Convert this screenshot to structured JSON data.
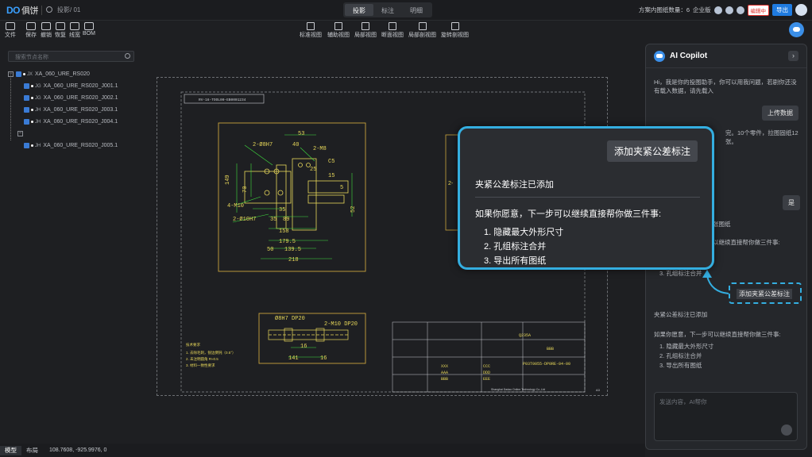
{
  "app": {
    "logo_mark": "DO",
    "brand": "俱饼",
    "doc_title": "投影/ 01"
  },
  "top_tabs": [
    "投影",
    "标注",
    "明细"
  ],
  "top_right": {
    "instance_info": "方案内图纸数量：6",
    "enterprise": "企业版",
    "edit_btn": "编辑中",
    "export_btn": "导出"
  },
  "toolbar": {
    "left": [
      "文件",
      "保存",
      "撤销",
      "恢复",
      "线宽",
      "BOM"
    ],
    "center": [
      "标准视图",
      "辅助视图",
      "局部视图",
      "断面视图",
      "局部剖视图",
      "旋转剖视图"
    ]
  },
  "sidebar": {
    "search_placeholder": "搜索节点名称",
    "root": "XA_060_URE_RS020",
    "children": [
      "XA_060_URE_RS020_J001.1",
      "XA_060_URE_RS020_J002.1",
      "XA_060_URE_RS020_J003.1",
      "XA_060_URE_RS020_J004.1",
      "XA_060_URE_RS020_J005.1"
    ],
    "tags": [
      "JX",
      "JG",
      "JG",
      "JH",
      "JH"
    ]
  },
  "drawing": {
    "title_block": "RV-16-TOOL00-EB0001234",
    "dims": [
      "53",
      "2-Ø8H7",
      "40",
      "2-M8",
      "149",
      "70",
      "25",
      "C5",
      "15",
      "4-M10",
      "35",
      "2-Ø10H7",
      "35",
      "89",
      "158",
      "179.5",
      "139.5",
      "50",
      "218",
      "52",
      "5"
    ],
    "section_dims": [
      "Ø8H7 DP20",
      "2-M10 DP20",
      "16",
      "141",
      "16"
    ],
    "notes_title": "技术要求",
    "notes": [
      "1. 去除毛刺，锐边倒钝（0.5°）",
      "2. 未注明圆角 R≈0.5",
      "3. 材料一致性要求"
    ],
    "tb_mat": "Q235A",
    "tb_part": "P03T0055-DP0RE-04-00",
    "tb_company": "Shanghai Dadao Online Technology Co.,Ltd",
    "tb_codes": [
      "XXX",
      "AAA",
      "BBB",
      "CCC",
      "DDD",
      "EEE"
    ],
    "tb_bbb": "BBB",
    "tb_scale": "A3"
  },
  "status_bar": {
    "tabs": [
      "模型",
      "布局"
    ],
    "coords": "108.7608,  -925.9976,  0"
  },
  "copilot": {
    "title": "AI Copilot",
    "greeting": "Hi，我是你的投图助手，你可以用我问题，若剧你还没有载入数据，请先载入",
    "upload_btn": "上传数据",
    "line1": "完。10个零件，拉图固纸12张。",
    "yes_btn": "是",
    "hide_dims": "张图纸",
    "next_hint": "以继续直接帮你做三件事:",
    "item3_partial": "3. 孔组标注合并",
    "added_status": "夹紧公差标注已添加",
    "followup": "如果你愿意，下一步可以继续直接帮你做三件事:",
    "list": [
      "1. 隐藏最大外形尺寸",
      "2. 孔组标注合并",
      "3. 导出所有图纸"
    ],
    "input_placeholder": "发送内容，AI帮你",
    "highlight_chip": "添加夹紧公差标注"
  },
  "popup": {
    "chip": "添加夹紧公差标注",
    "status": "夹紧公差标注已添加",
    "intro": "如果你愿意，下一步可以继续直接帮你做三件事:",
    "items": [
      "1. 隐藏最大外形尺寸",
      "2. 孔组标注合并",
      "3. 导出所有图纸"
    ]
  },
  "colors": {
    "accent": "#34aee0",
    "cad_yellow": "#e8d85a",
    "cad_green": "#3fe03f",
    "cad_frame": "#c9a33c"
  }
}
